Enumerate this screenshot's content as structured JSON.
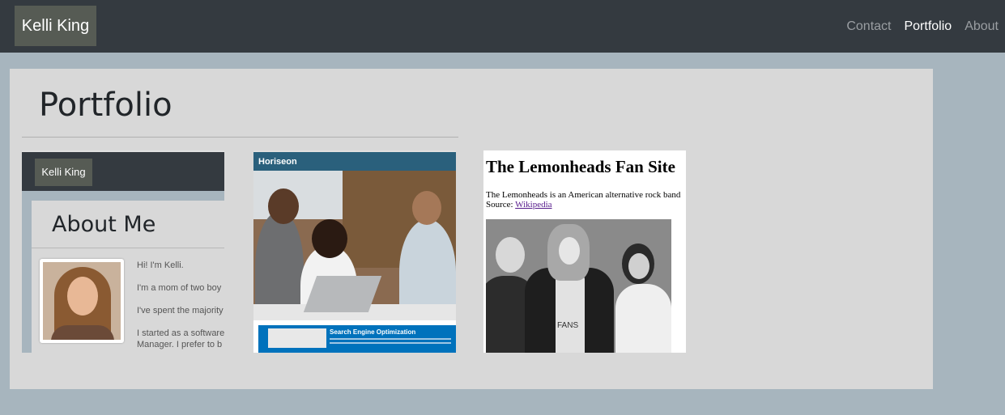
{
  "navbar": {
    "brand": "Kelli King",
    "links": [
      {
        "label": "Contact",
        "active": false
      },
      {
        "label": "Portfolio",
        "active": true
      },
      {
        "label": "About",
        "active": false
      }
    ]
  },
  "main": {
    "title": "Portfolio",
    "projects": [
      {
        "name": "about-me",
        "nav_brand": "Kelli King",
        "heading": "About Me",
        "lines": [
          "Hi! I'm Kelli.",
          "I'm a mom of two boy",
          "I've spent the majority",
          "I started as a software",
          "Manager. I prefer to b"
        ]
      },
      {
        "name": "horiseon",
        "logo": "Horiseon",
        "section_title": "Search Engine Optimization"
      },
      {
        "name": "lemonheads",
        "title": "The Lemonheads Fan Site",
        "description": "The Lemonheads is an American alternative rock band",
        "source_label": "Source: ",
        "source_link": "Wikipedia",
        "shirt_text": "FANS"
      }
    ]
  },
  "colors": {
    "navbar_bg": "#343a40",
    "page_bg": "#a7b5be",
    "panel_bg": "#d8d8d8",
    "brand_bg": "#565b54",
    "horiseon_blue": "#2a607c"
  }
}
